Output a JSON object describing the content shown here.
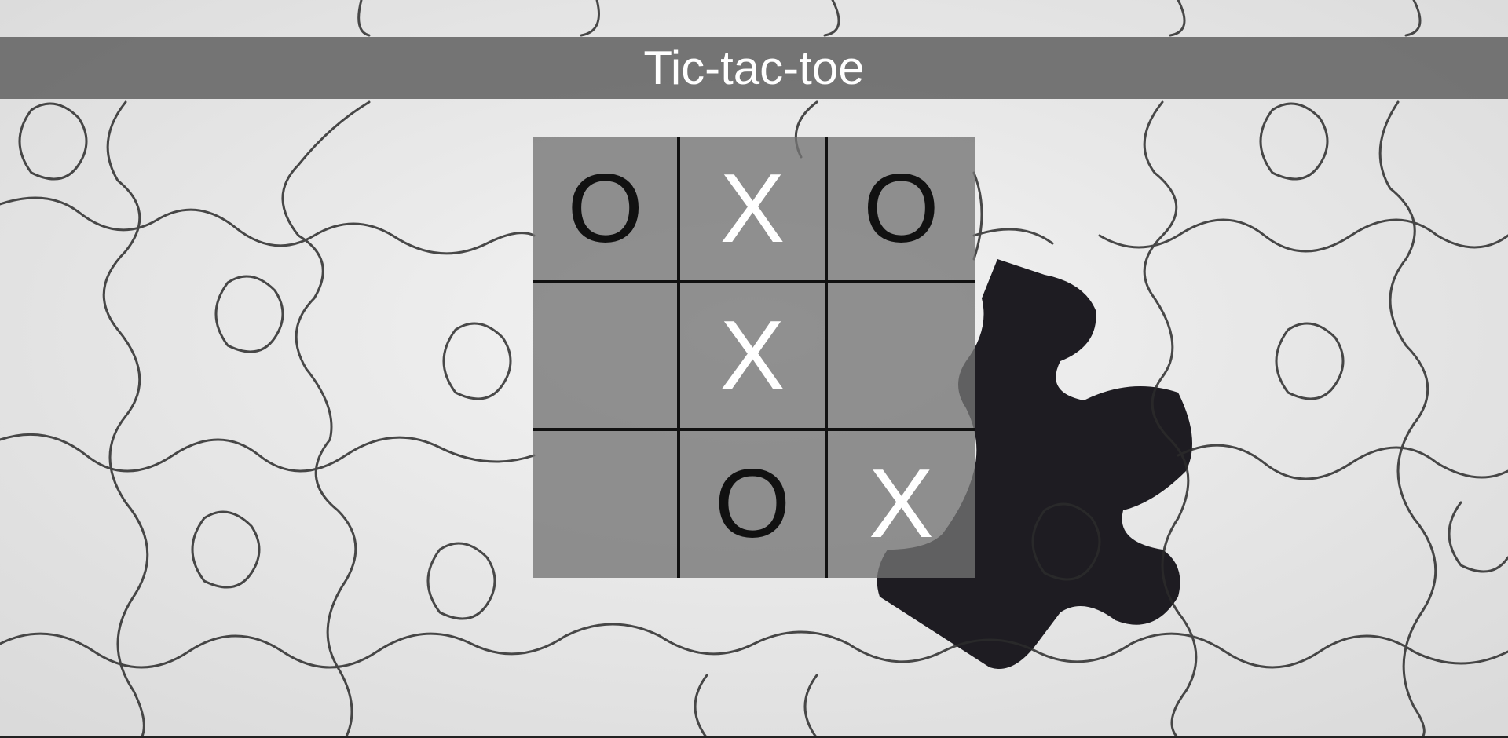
{
  "title": "Tic-tac-toe",
  "board": [
    [
      "O",
      "X",
      "O"
    ],
    [
      "",
      "X",
      ""
    ],
    [
      "",
      "O",
      "X"
    ]
  ],
  "colors": {
    "x_mark": "#ffffff",
    "o_mark": "#111111",
    "cell_bg": "#737373",
    "banner_bg": "#646464",
    "grid_lines": "#111111"
  },
  "background": {
    "theme": "white jigsaw puzzle with one missing piece"
  }
}
